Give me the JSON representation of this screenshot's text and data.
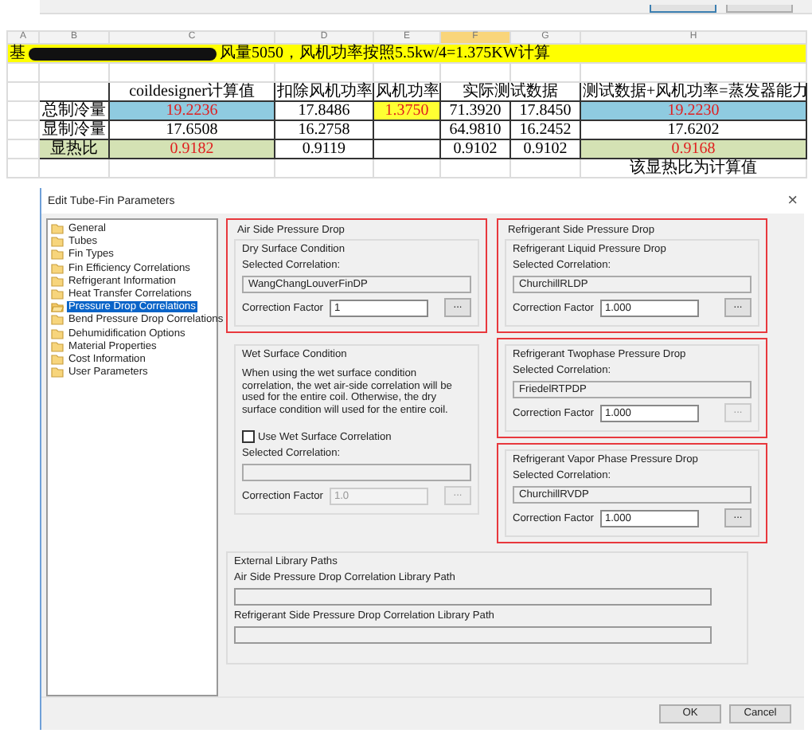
{
  "spreadsheet": {
    "column_letters": [
      {
        "label": "A",
        "selected": false
      },
      {
        "label": "B",
        "selected": false
      },
      {
        "label": "C",
        "selected": false
      },
      {
        "label": "D",
        "selected": false
      },
      {
        "label": "E",
        "selected": false
      },
      {
        "label": "F",
        "selected": true
      },
      {
        "label": "G",
        "selected": false
      },
      {
        "label": "H",
        "selected": false
      }
    ],
    "title_row": {
      "text_before": "基",
      "redacted": true,
      "text_after": "风量5050，风机功率按照5.5kw/4=1.375KW计算"
    },
    "table": {
      "headers": [
        {
          "text": "coildesigner计算值",
          "merged": false
        },
        {
          "text": "扣除风机功率",
          "merged": false
        },
        {
          "text": "风机功率",
          "merged": false
        },
        {
          "text": "实际测试数据",
          "merged": true
        },
        {
          "text": "测试数据+风机功率=蒸发器能力",
          "merged": false
        }
      ],
      "rows": [
        {
          "label": {
            "text": "总制冷量"
          },
          "cells": [
            {
              "text": "19.2236",
              "color": "#8fcbe0",
              "emphasis": true
            },
            {
              "text": "17.8486",
              "emphasis": false
            },
            {
              "text": "1.3750",
              "color": "#ffff33",
              "emphasis": true
            },
            {
              "text": "71.3920",
              "emphasis": false
            },
            {
              "text": "17.8450",
              "emphasis": false
            },
            {
              "text": "19.2230",
              "color": "#8fcbe0",
              "emphasis": true
            }
          ]
        },
        {
          "label": {
            "text": "显制冷量"
          },
          "cells": [
            {
              "text": "17.6508",
              "emphasis": false
            },
            {
              "text": "16.2758",
              "emphasis": false
            },
            {},
            {
              "text": "64.9810",
              "emphasis": false
            },
            {
              "text": "16.2452",
              "emphasis": false
            },
            {
              "text": "17.6202",
              "emphasis": false
            }
          ]
        },
        {
          "label": {
            "text": "显热比",
            "color": "#d4e2b4"
          },
          "cells": [
            {
              "text": "0.9182",
              "color": "#d4e2b4",
              "emphasis": true
            },
            {
              "text": "0.9119",
              "emphasis": false
            },
            {},
            {
              "text": "0.9102",
              "emphasis": false
            },
            {
              "text": "0.9102",
              "emphasis": false
            },
            {
              "text": "0.9168",
              "color": "#d4e2b4",
              "emphasis": true
            }
          ]
        }
      ]
    },
    "note": "该显热比为计算值"
  },
  "dialog": {
    "title": "Edit Tube-Fin Parameters",
    "close": "×",
    "tree": [
      {
        "label": "General",
        "selected": false
      },
      {
        "label": "Tubes",
        "selected": false
      },
      {
        "label": "Fin Types",
        "selected": false
      },
      {
        "label": "Fin Efficiency Correlations",
        "selected": false
      },
      {
        "label": "Refrigerant Information",
        "selected": false
      },
      {
        "label": "Heat Transfer Correlations",
        "selected": false
      },
      {
        "label": "Pressure Drop Correlations",
        "selected": true
      },
      {
        "label": "Bend Pressure Drop Correlations",
        "selected": false
      },
      {
        "label": "Dehumidification Options",
        "selected": false
      },
      {
        "label": "Material Properties",
        "selected": false
      },
      {
        "label": "Cost Information",
        "selected": false
      },
      {
        "label": "User Parameters",
        "selected": false
      }
    ],
    "left_panels": [
      {
        "title": "Air Side Pressure Drop",
        "highlighted": true,
        "section": {
          "title": "Dry Surface Condition",
          "selected_label": "Selected Correlation:",
          "correlation": "WangChangLouverFinDP",
          "factor_label": "Correction Factor",
          "factor": "1",
          "button": "...",
          "disabled": false,
          "button_disabled": false
        }
      },
      {
        "highlighted": false,
        "section": {
          "title": "Wet Surface Condition",
          "description": "When using the wet surface condition correlation, the wet air-side correlation will be used for the entire coil. Otherwise, the dry surface condition will used for the entire coil.",
          "checkbox": {
            "label": "Use Wet Surface Correlation",
            "checked": false
          },
          "selected_label": "Selected Correlation:",
          "factor_label": "Correction Factor",
          "factor": "1.0",
          "button": "...",
          "disabled": true,
          "button_disabled": true
        }
      }
    ],
    "right_panels": [
      {
        "title": "Refrigerant Side Pressure Drop",
        "highlighted": true,
        "section": {
          "title": "Refrigerant Liquid Pressure Drop",
          "selected_label": "Selected Correlation:",
          "correlation": "ChurchillRLDP",
          "factor_label": "Correction Factor",
          "factor": "1.000",
          "button": "...",
          "disabled": false,
          "button_disabled": false
        }
      },
      {
        "highlighted": true,
        "section": {
          "title": "Refrigerant Twophase Pressure Drop",
          "selected_label": "Selected Correlation:",
          "correlation": "FriedelRTPDP",
          "factor_label": "Correction Factor",
          "factor": "1.000",
          "button": "...",
          "disabled": false,
          "button_disabled": true
        }
      },
      {
        "highlighted": true,
        "section": {
          "title": "Refrigerant Vapor Phase Pressure Drop",
          "selected_label": "Selected Correlation:",
          "correlation": "ChurchillRVDP",
          "factor_label": "Correction Factor",
          "factor": "1.000",
          "button": "...",
          "disabled": false,
          "button_disabled": false
        }
      }
    ],
    "external": {
      "title": "External Library Paths",
      "paths": [
        {
          "label": "Air Side Pressure Drop Correlation Library Path"
        },
        {
          "label": "Refrigerant Side Pressure Drop Correlation Library Path"
        }
      ]
    },
    "buttons": [
      "OK",
      "Cancel"
    ]
  }
}
